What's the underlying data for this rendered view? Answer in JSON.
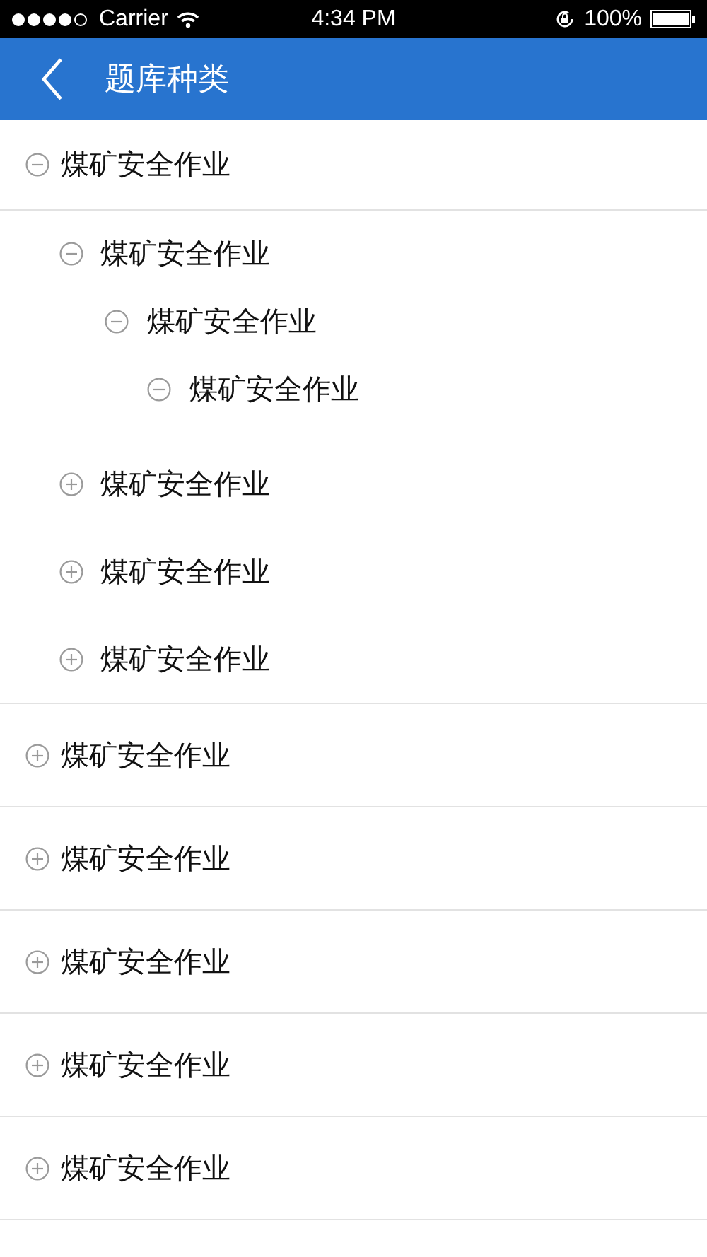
{
  "status_bar": {
    "carrier": "Carrier",
    "time": "4:34 PM",
    "battery": "100%"
  },
  "nav_bar": {
    "title": "题库种类"
  },
  "tree": [
    {
      "label": "煤矿安全作业",
      "expanded": true,
      "children": [
        {
          "label": "煤矿安全作业",
          "expanded": true,
          "children": [
            {
              "label": "煤矿安全作业",
              "expanded": true,
              "children": [
                {
                  "label": "煤矿安全作业",
                  "expanded": true
                }
              ]
            }
          ]
        },
        {
          "label": "煤矿安全作业",
          "expanded": false
        },
        {
          "label": "煤矿安全作业",
          "expanded": false
        },
        {
          "label": "煤矿安全作业",
          "expanded": false
        }
      ]
    },
    {
      "label": "煤矿安全作业",
      "expanded": false
    },
    {
      "label": "煤矿安全作业",
      "expanded": false
    },
    {
      "label": "煤矿安全作业",
      "expanded": false
    },
    {
      "label": "煤矿安全作业",
      "expanded": false
    },
    {
      "label": "煤矿安全作业",
      "expanded": false
    }
  ]
}
